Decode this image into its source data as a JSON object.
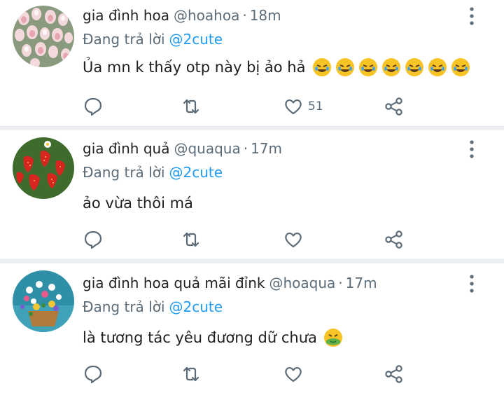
{
  "tweets": [
    {
      "name": "gia đình hoa",
      "handle": "@hoahoa",
      "time": "18m",
      "reply_prefix": "Đang trả lời",
      "reply_to": "@2cute",
      "text": "Ủa mn k thấy otp này bị ảo hả",
      "emojis": [
        "rofl-emoji",
        "rofl-emoji",
        "rofl-emoji",
        "rofl-emoji",
        "rofl-emoji",
        "rofl-emoji",
        "rofl-emoji"
      ],
      "likes": "51",
      "avatar": "pink-flowers"
    },
    {
      "name": "gia đình quả",
      "handle": "@quaqua",
      "time": "17m",
      "reply_prefix": "Đang trả lời",
      "reply_to": "@2cute",
      "text": "ảo vừa thôi má",
      "emojis": [],
      "likes": "",
      "avatar": "strawberries"
    },
    {
      "name": "gia đình hoa quả mãi đỉnk",
      "handle": "@hoaqua",
      "time": "17m",
      "reply_prefix": "Đang trả lời",
      "reply_to": "@2cute",
      "text": "là tương tác yêu đương dữ chưa",
      "emojis": [
        "nauseated-emoji"
      ],
      "likes": "",
      "avatar": "flower-basket"
    }
  ],
  "icons": {
    "reply": "comment-icon",
    "retweet": "retweet-icon",
    "like": "heart-icon",
    "share": "share-icon",
    "more": "more-vertical-icon"
  },
  "colors": {
    "mention": "#1d9bf0",
    "muted": "#5b6b78",
    "divider": "#eef1f4"
  }
}
